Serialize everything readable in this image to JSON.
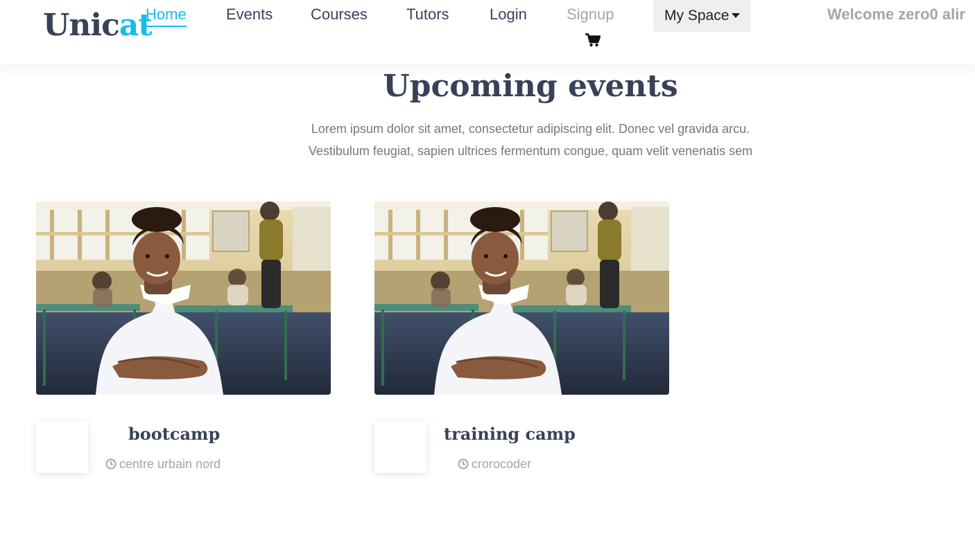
{
  "header": {
    "logo": {
      "part1": "Unic",
      "part2": "at"
    },
    "nav": [
      {
        "label": "Home"
      },
      {
        "label": "Events"
      },
      {
        "label": "Courses"
      },
      {
        "label": "Tutors"
      },
      {
        "label": "Login"
      },
      {
        "label": "Signup"
      }
    ],
    "cart_icon": "shopping-cart-icon",
    "my_space": "My Space",
    "welcome": "Welcome zero0 alir"
  },
  "section": {
    "title": "Upcoming events",
    "text": "Lorem ipsum dolor sit amet, consectetur adipiscing elit. Donec vel gravida arcu. Vestibulum feugiat, sapien ultrices fermentum congue, quam velit venenatis sem"
  },
  "events": [
    {
      "title": "bootcamp",
      "location": "centre urbain nord",
      "image": "smiling-boy-classroom-photo"
    },
    {
      "title": "training camp",
      "location": "crorocoder",
      "image": "smiling-boy-classroom-photo"
    }
  ],
  "colors": {
    "accent": "#14bdee",
    "heading": "#384158",
    "muted": "#a5a5a5",
    "body_text": "#76777a"
  }
}
